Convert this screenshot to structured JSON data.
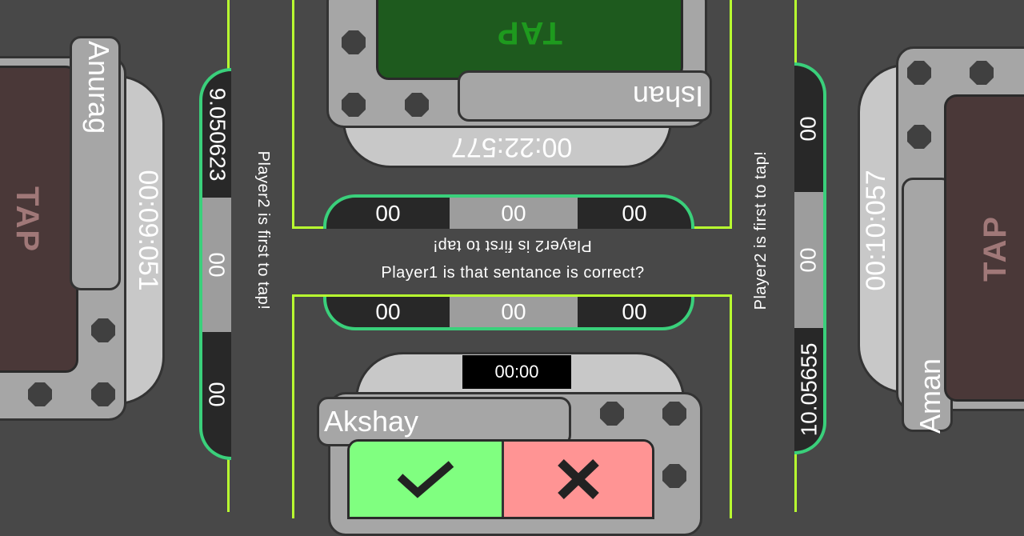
{
  "colors": {
    "background": "#484848",
    "lime_border": "#b8ff30",
    "score_border": "#3ad07b",
    "tap_green": "#1e5a1e",
    "tap_brown": "#4a3838",
    "correct_green": "#80ff80",
    "wrong_red": "#ff9494"
  },
  "top_player": {
    "name": "Ishan",
    "timer": "00:22:577",
    "tap_label": "TAP",
    "scores": [
      "00",
      "00",
      "00"
    ],
    "message": "Player2 is first to tap!"
  },
  "bottom_player": {
    "name": "Akshay",
    "timer": "00:00",
    "scores": [
      "00",
      "00",
      "00"
    ],
    "question": "Player1 is that sentance is correct?",
    "correct_icon": "checkmark-icon",
    "wrong_icon": "cross-icon"
  },
  "left_player": {
    "name": "Anurag",
    "timer": "00:09:051",
    "tap_label": "TAP",
    "scores": [
      "9.050623",
      "00",
      "00"
    ],
    "message": "Player2 is first to tap!"
  },
  "right_player": {
    "name": "Aman",
    "timer": "00:10:057",
    "tap_label": "TAP",
    "scores": [
      "00",
      "00",
      "10.05655"
    ],
    "message": "Player2 is first to tap!"
  }
}
